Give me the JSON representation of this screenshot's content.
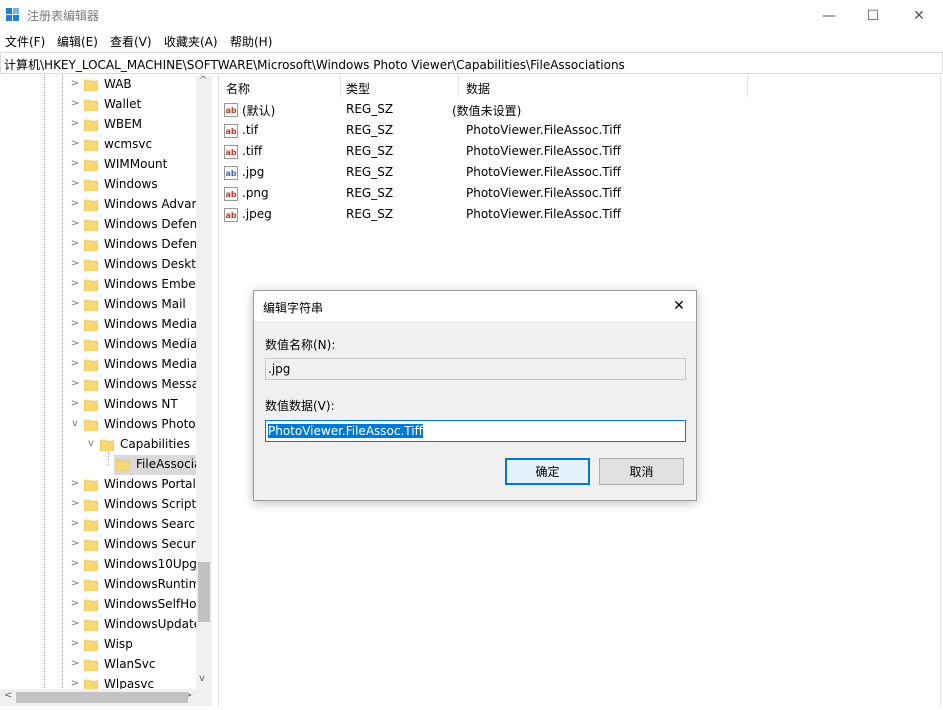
{
  "window": {
    "title": "注册表编辑器",
    "minimize_glyph": "—",
    "maximize_glyph": "☐",
    "close_glyph": "✕"
  },
  "menu": [
    {
      "label": "文件(F)"
    },
    {
      "label": "编辑(E)"
    },
    {
      "label": "查看(V)"
    },
    {
      "label": "收藏夹(A)"
    },
    {
      "label": "帮助(H)"
    }
  ],
  "address": "计算机\\HKEY_LOCAL_MACHINE\\SOFTWARE\\Microsoft\\Windows Photo Viewer\\Capabilities\\FileAssociations",
  "tree": {
    "items": [
      {
        "label": "WAB",
        "chevron": ">"
      },
      {
        "label": "Wallet",
        "chevron": ">"
      },
      {
        "label": "WBEM",
        "chevron": ">"
      },
      {
        "label": "wcmsvc",
        "chevron": ">"
      },
      {
        "label": "WIMMount",
        "chevron": ">"
      },
      {
        "label": "Windows",
        "chevron": ">"
      },
      {
        "label": "Windows Advar",
        "chevron": ">"
      },
      {
        "label": "Windows Defen",
        "chevron": ">"
      },
      {
        "label": "Windows Defen",
        "chevron": ">"
      },
      {
        "label": "Windows Deskt",
        "chevron": ">"
      },
      {
        "label": "Windows Embe",
        "chevron": ">"
      },
      {
        "label": "Windows Mail",
        "chevron": ">"
      },
      {
        "label": "Windows Media",
        "chevron": ">"
      },
      {
        "label": "Windows Media",
        "chevron": ">"
      },
      {
        "label": "Windows Media",
        "chevron": ">"
      },
      {
        "label": "Windows Messa",
        "chevron": ">"
      },
      {
        "label": "Windows NT",
        "chevron": ">"
      },
      {
        "label": "Windows Photo",
        "chevron": "v"
      },
      {
        "label": "Capabilities",
        "chevron": "v"
      },
      {
        "label": "FileAssocia",
        "chevron": ""
      },
      {
        "label": "Windows Portal",
        "chevron": ">"
      },
      {
        "label": "Windows Script",
        "chevron": ">"
      },
      {
        "label": "Windows Searcl",
        "chevron": ">"
      },
      {
        "label": "Windows Securi",
        "chevron": ">"
      },
      {
        "label": "Windows10Upg",
        "chevron": ">"
      },
      {
        "label": "WindowsRuntim",
        "chevron": ">"
      },
      {
        "label": "WindowsSelfHo",
        "chevron": ">"
      },
      {
        "label": "WindowsUpdate",
        "chevron": ">"
      },
      {
        "label": "Wisp",
        "chevron": ">"
      },
      {
        "label": "WlanSvc",
        "chevron": ">"
      },
      {
        "label": "Wlpasvc",
        "chevron": ">"
      }
    ],
    "scroll_up": "^",
    "scroll_down": "v",
    "scroll_left": "<",
    "scroll_right": ">"
  },
  "list": {
    "headers": {
      "name": "名称",
      "type": "类型",
      "data": "数据"
    },
    "rows": [
      {
        "name": "(默认)",
        "type": "REG_SZ",
        "data": "(数值未设置)"
      },
      {
        "name": ".tif",
        "type": "REG_SZ",
        "data": "PhotoViewer.FileAssoc.Tiff"
      },
      {
        "name": ".tiff",
        "type": "REG_SZ",
        "data": "PhotoViewer.FileAssoc.Tiff"
      },
      {
        "name": ".jpg",
        "type": "REG_SZ",
        "data": "PhotoViewer.FileAssoc.Tiff"
      },
      {
        "name": ".png",
        "type": "REG_SZ",
        "data": "PhotoViewer.FileAssoc.Tiff"
      },
      {
        "name": ".jpeg",
        "type": "REG_SZ",
        "data": "PhotoViewer.FileAssoc.Tiff"
      }
    ]
  },
  "dialog": {
    "title": "编辑字符串",
    "close_glyph": "✕",
    "name_label": "数值名称(N):",
    "name_value": ".jpg",
    "data_label": "数值数据(V):",
    "data_value": "PhotoViewer.FileAssoc.Tiff",
    "ok_label": "确定",
    "cancel_label": "取消"
  },
  "colors": {
    "accent": "#0078d7",
    "folder": "#f8d775",
    "folder_dark": "#e0b84a",
    "regsz_icon": "#c0392b"
  }
}
